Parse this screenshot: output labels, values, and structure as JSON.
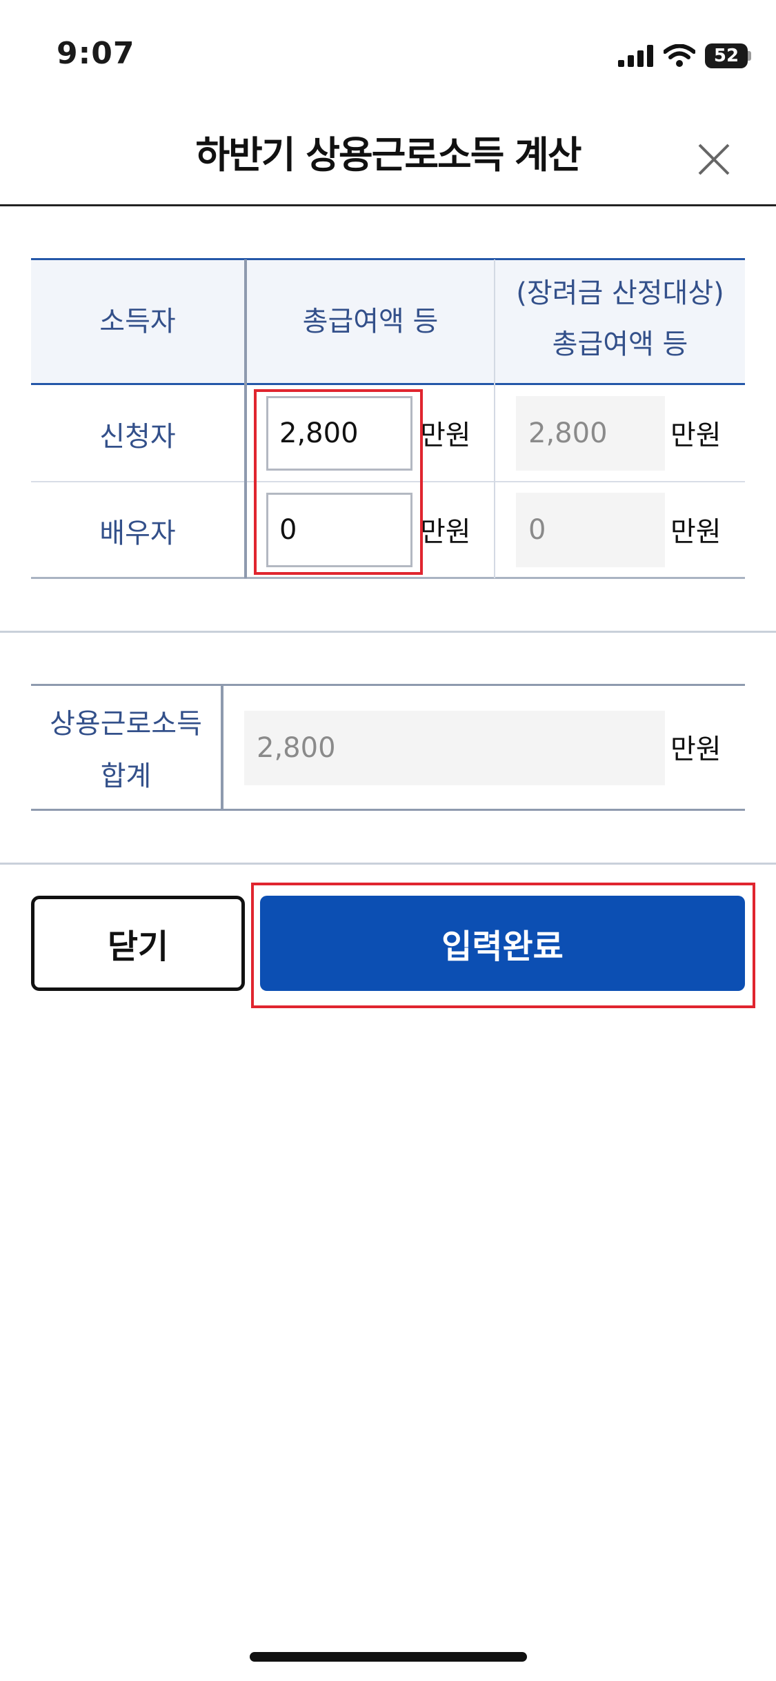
{
  "status_bar": {
    "time": "9:07",
    "battery": "52",
    "icons": [
      "signal-icon",
      "wifi-icon",
      "battery-icon"
    ]
  },
  "header": {
    "title": "하반기 상용근로소득 계산",
    "close_icon": "close-icon"
  },
  "income_table": {
    "headers": {
      "earner": "소득자",
      "gross_pay": "총급여액 등",
      "eligible_line1": "(장려금 산정대상)",
      "eligible_line2": "총급여액 등"
    },
    "rows": [
      {
        "label": "신청자",
        "input_value": "2,800",
        "readonly_value": "2,800",
        "unit": "만원"
      },
      {
        "label": "배우자",
        "input_value": "0",
        "readonly_value": "0",
        "unit": "만원"
      }
    ]
  },
  "total": {
    "label_line1": "상용근로소득",
    "label_line2": "합계",
    "value": "2,800",
    "unit": "만원"
  },
  "buttons": {
    "close_label": "닫기",
    "submit_label": "입력완료"
  },
  "colors": {
    "accent": "#0c4fb3",
    "header_text": "#33508a",
    "highlight": "#e0252f"
  }
}
